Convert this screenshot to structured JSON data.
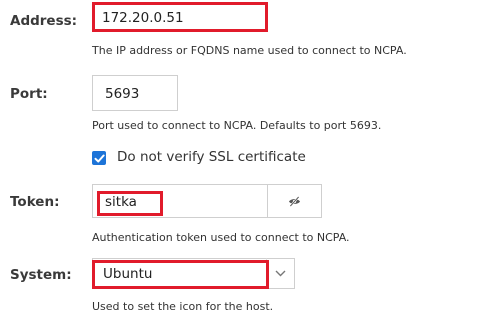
{
  "address": {
    "label": "Address:",
    "value": "172.20.0.51",
    "help": "The IP address or FQDNS name used to connect to NCPA."
  },
  "port": {
    "label": "Port:",
    "value": "5693",
    "help": "Port used to connect to NCPA. Defaults to port 5693."
  },
  "ssl": {
    "checked": true,
    "label": "Do not verify SSL certificate"
  },
  "token": {
    "label": "Token:",
    "value": "sitka",
    "help": "Authentication token used to connect to NCPA.",
    "toggle_icon": "eye-slash-icon"
  },
  "system": {
    "label": "System:",
    "value": "Ubuntu",
    "help": "Used to set the icon for the host."
  },
  "colors": {
    "highlight": "#e11b2b",
    "checkbox": "#1d74d8"
  }
}
